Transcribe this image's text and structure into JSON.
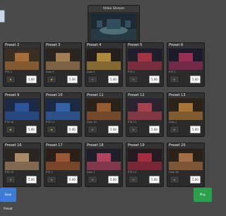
{
  "video_stream": {
    "title": "Video Stream"
  },
  "presets": [
    {
      "name": "Preset 2",
      "caption": "PTZ 2",
      "fav": true,
      "duration": "5.00"
    },
    {
      "name": "Preset 3",
      "caption": "Cam 3",
      "fav": true,
      "duration": "5.00"
    },
    {
      "name": "Preset 4",
      "caption": "Cam 3",
      "fav": false,
      "duration": "5.00"
    },
    {
      "name": "Preset 5",
      "caption": "PTZ 1",
      "fav": false,
      "duration": "5.00"
    },
    {
      "name": "Preset 6",
      "caption": "PTZ 1",
      "fav": false,
      "duration": "5.00"
    },
    {
      "name": "Preset 9",
      "caption": "PTZ 16",
      "fav": true,
      "duration": "5.00"
    },
    {
      "name": "Preset 10",
      "caption": "PTZ 11",
      "fav": true,
      "duration": "5.00"
    },
    {
      "name": "Preset 11",
      "caption": "Cam 10",
      "fav": false,
      "duration": "5.00"
    },
    {
      "name": "Preset 12",
      "caption": "PTZ 11",
      "fav": false,
      "duration": "5.00"
    },
    {
      "name": "Preset 13",
      "caption": "Cam 1",
      "fav": false,
      "duration": "5.00"
    },
    {
      "name": "Preset 16",
      "caption": "PTZ 15",
      "fav": false,
      "duration": "5.00"
    },
    {
      "name": "Preset 17",
      "caption": "PTZ 1",
      "fav": false,
      "duration": "5.00"
    },
    {
      "name": "Preset 18",
      "caption": "Cam 1",
      "fav": false,
      "duration": "5.00"
    },
    {
      "name": "Preset 19",
      "caption": "PTZ 17",
      "fav": false,
      "duration": "5.00"
    },
    {
      "name": "Preset 20",
      "caption": "Cam 18",
      "fav": false,
      "duration": "5.00"
    }
  ],
  "buttons": {
    "save_preset": "Save Preset",
    "play": "Play"
  },
  "colors": {
    "save": "#3d7bd6",
    "play": "#2aa04a",
    "star_on": "#f3c623"
  }
}
